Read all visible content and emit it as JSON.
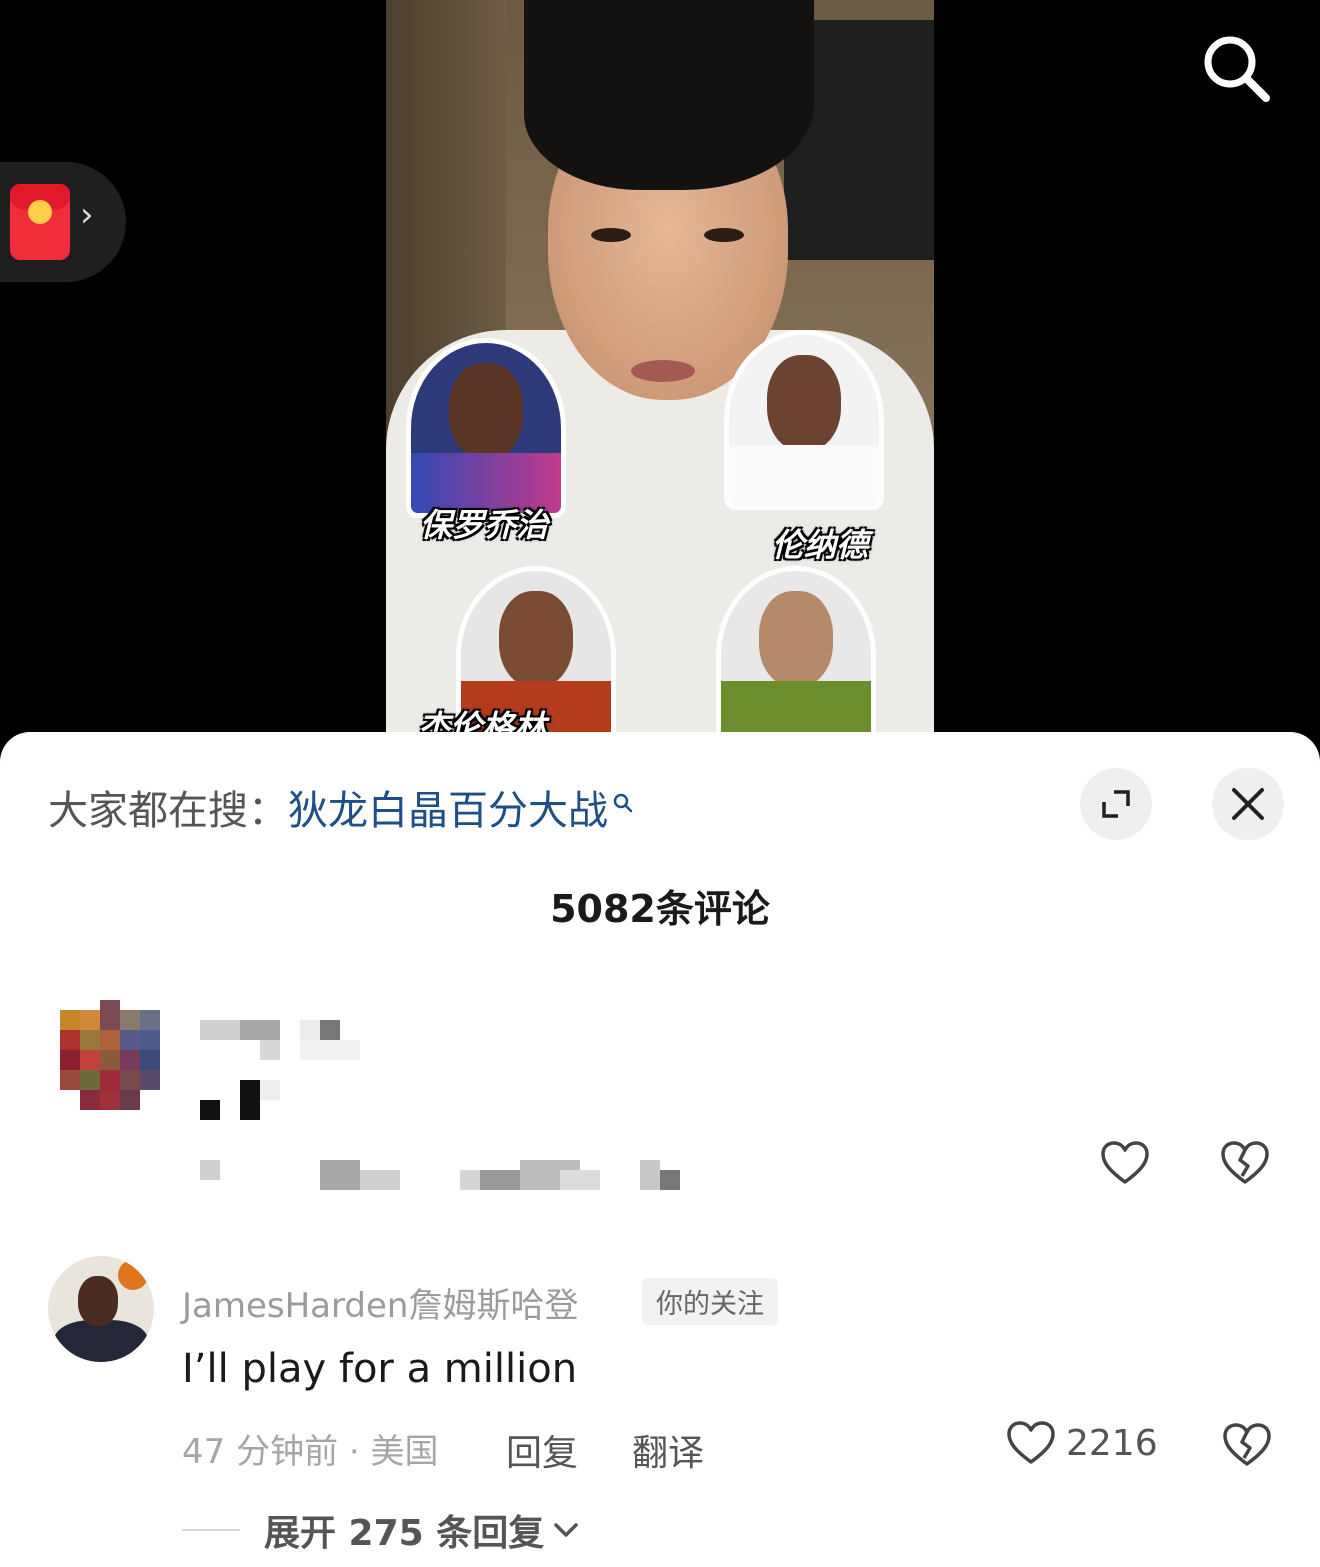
{
  "video": {
    "sticker_labels": [
      "保罗乔治",
      "伦纳德",
      "杰伦格林"
    ],
    "icons": {
      "search": "search-icon",
      "red_packet": "red-packet-icon",
      "chevron": "chevron-right-icon"
    },
    "red_packet_chevron": "›"
  },
  "sheet": {
    "hot_search_prefix": "大家都在搜：",
    "hot_search_term": "狄龙白晶百分大战",
    "comment_count_title": "5082条评论"
  },
  "comment": {
    "username": "JamesHarden詹姆斯哈登",
    "badge": "你的关注",
    "text": "I’ll play for a million",
    "meta": "47 分钟前 · 美国",
    "reply_label": "回复",
    "translate_label": "翻译",
    "like_count": "2216",
    "expand_label": "展开 275 条回复"
  },
  "colors": {
    "link_blue": "#1e4f86",
    "red_packet": "#f22d3b",
    "sheet_bg": "#ffffff"
  }
}
